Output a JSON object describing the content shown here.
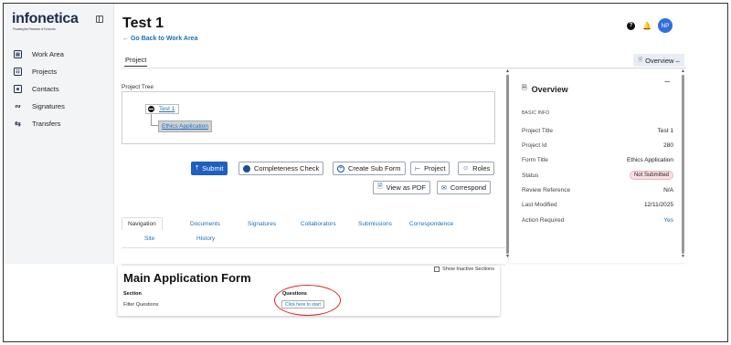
{
  "app": {
    "logo": "infonetica",
    "tagline": "Powering the Research of Tomorrow"
  },
  "sidebar": {
    "items": [
      {
        "label": "Work Area",
        "icon": "work-area-icon"
      },
      {
        "label": "Projects",
        "icon": "projects-icon"
      },
      {
        "label": "Contacts",
        "icon": "contacts-icon"
      },
      {
        "label": "Signatures",
        "icon": "signature-icon"
      },
      {
        "label": "Transfers",
        "icon": "transfer-icon"
      }
    ]
  },
  "header": {
    "title": "Test 1",
    "back_link": "← Go Back to Work Area",
    "help": "?",
    "avatar_initials": "NP"
  },
  "tabs": {
    "project": "Project",
    "overview_button": "Overview –"
  },
  "project_tree": {
    "label": "Project Tree",
    "root": "Test 1",
    "child": "Ethics Application"
  },
  "actions": {
    "submit": "Submit",
    "completeness": "Completeness Check",
    "create_sub_form": "Create Sub Form",
    "project": "Project",
    "roles": "Roles",
    "view_pdf": "View as PDF",
    "correspond": "Correspond"
  },
  "subtabs": [
    "Navigation",
    "Documents",
    "Signatures",
    "Collaborators",
    "Submissions",
    "Correspondence",
    "Site",
    "History"
  ],
  "form": {
    "title": "Main Application Form",
    "show_inactive": "Show Inactive Sections",
    "section_header": "Section",
    "section_value": "Filter Questions",
    "questions_header": "Questions",
    "start_button": "Click here to start"
  },
  "overview": {
    "title": "Overview",
    "collapse": "–",
    "section": "BASIC INFO",
    "rows": [
      {
        "key": "Project Title",
        "value": "Test 1"
      },
      {
        "key": "Project Id",
        "value": "280"
      },
      {
        "key": "Form Title",
        "value": "Ethics Application"
      },
      {
        "key": "Status",
        "value": "Not Submitted"
      },
      {
        "key": "Review Reference",
        "value": "N/A"
      },
      {
        "key": "Last Modified",
        "value": "12/11/2025"
      },
      {
        "key": "Action Required",
        "value": "Yes"
      }
    ]
  },
  "colors": {
    "brand": "#1b2d4a",
    "primary": "#1f5fbf",
    "link": "#1d6fb8",
    "highlight": "#dd2222"
  }
}
